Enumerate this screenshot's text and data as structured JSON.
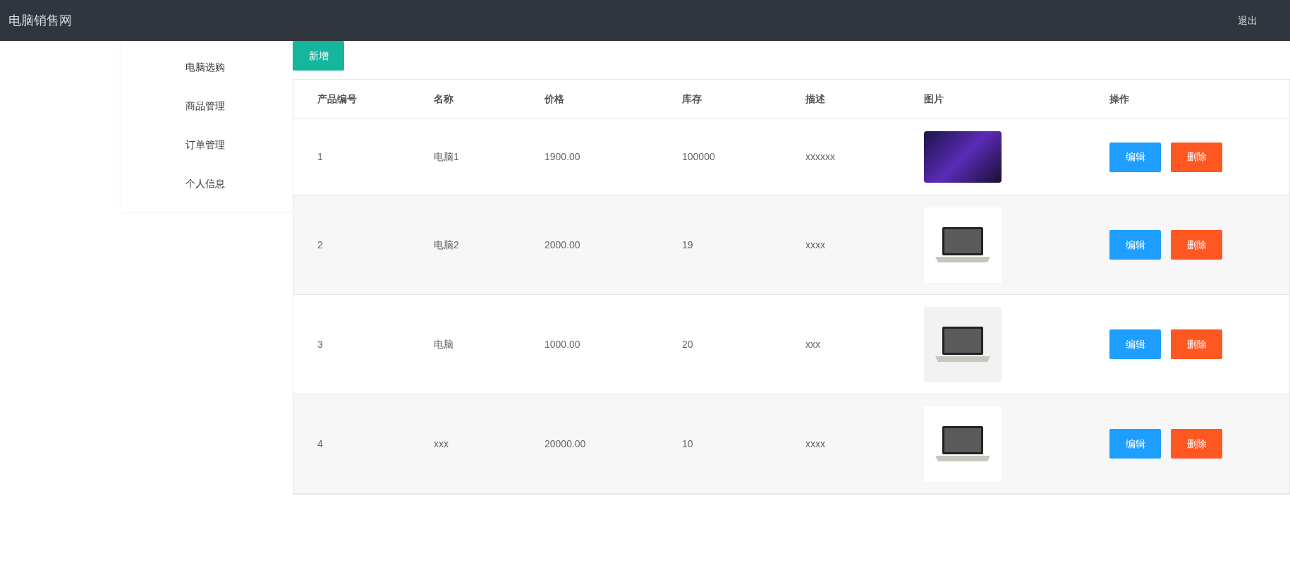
{
  "header": {
    "title": "电脑销售网",
    "logout": "退出"
  },
  "sidebar": {
    "items": [
      {
        "label": "电脑选购"
      },
      {
        "label": "商品管理"
      },
      {
        "label": "订单管理"
      },
      {
        "label": "个人信息"
      }
    ]
  },
  "add_button": "新增",
  "table": {
    "columns": [
      "产品编号",
      "名称",
      "价格",
      "库存",
      "描述",
      "图片",
      "操作"
    ],
    "rows": [
      {
        "id": "1",
        "name": "电脑1",
        "price": "1900.00",
        "stock": "100000",
        "desc": "xxxxxx",
        "image": {
          "kind": "banner"
        },
        "actions": [
          "编辑",
          "删除"
        ]
      },
      {
        "id": "2",
        "name": "电脑2",
        "price": "2000.00",
        "stock": "19",
        "desc": "xxxx",
        "image": {
          "kind": "laptop"
        },
        "actions": [
          "编辑",
          "删除"
        ]
      },
      {
        "id": "3",
        "name": "电脑",
        "price": "1000.00",
        "stock": "20",
        "desc": "xxx",
        "image": {
          "kind": "laptop-grey"
        },
        "actions": [
          "编辑",
          "删除"
        ]
      },
      {
        "id": "4",
        "name": "xxx",
        "price": "20000.00",
        "stock": "10",
        "desc": "xxxx",
        "image": {
          "kind": "laptop"
        },
        "actions": [
          "编辑",
          "删除"
        ]
      }
    ]
  }
}
